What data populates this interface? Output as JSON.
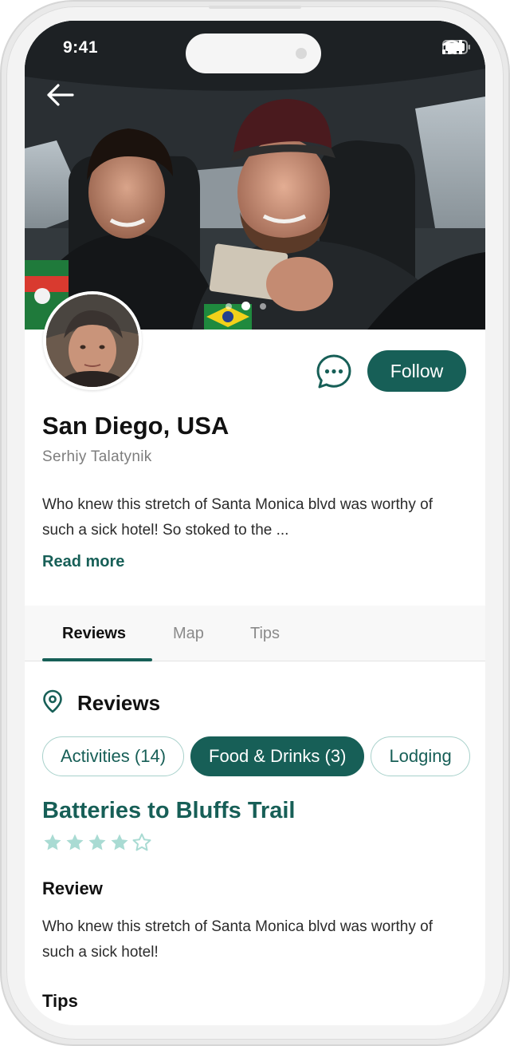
{
  "status_bar": {
    "time": "9:41"
  },
  "hero": {
    "carousel": {
      "count": 3,
      "active_index": 1
    }
  },
  "profile": {
    "title": "San Diego, USA",
    "author": "Serhiy Talatynik",
    "bio": "Who knew this stretch of Santa Monica blvd was worthy of such a sick hotel! So stoked to the ...",
    "read_more": "Read more",
    "follow_label": "Follow"
  },
  "tabs": [
    {
      "label": "Reviews",
      "active": true
    },
    {
      "label": "Map",
      "active": false
    },
    {
      "label": "Tips",
      "active": false
    }
  ],
  "reviews_section": {
    "title": "Reviews",
    "chips": [
      {
        "label": "Activities (14)",
        "active": false
      },
      {
        "label": "Food & Drinks (3)",
        "active": true
      },
      {
        "label": "Lodging",
        "active": false
      }
    ]
  },
  "review": {
    "place_name": "Batteries to Bluffs Trail",
    "rating": 4,
    "rating_max": 5,
    "review_heading": "Review",
    "review_text": "Who knew this stretch of Santa Monica blvd was worthy of such a sick hotel!",
    "tips_heading": "Tips"
  },
  "icons": {
    "back": "arrow-left-icon",
    "chat": "chat-bubble-icon",
    "location": "map-pin-icon",
    "star": "star-icon",
    "signal": "cellular-signal-icon",
    "wifi": "wifi-icon",
    "battery": "battery-icon"
  },
  "colors": {
    "accent": "#175f57",
    "star": "#a9dbd3",
    "chip_border": "#a8d1cb"
  }
}
